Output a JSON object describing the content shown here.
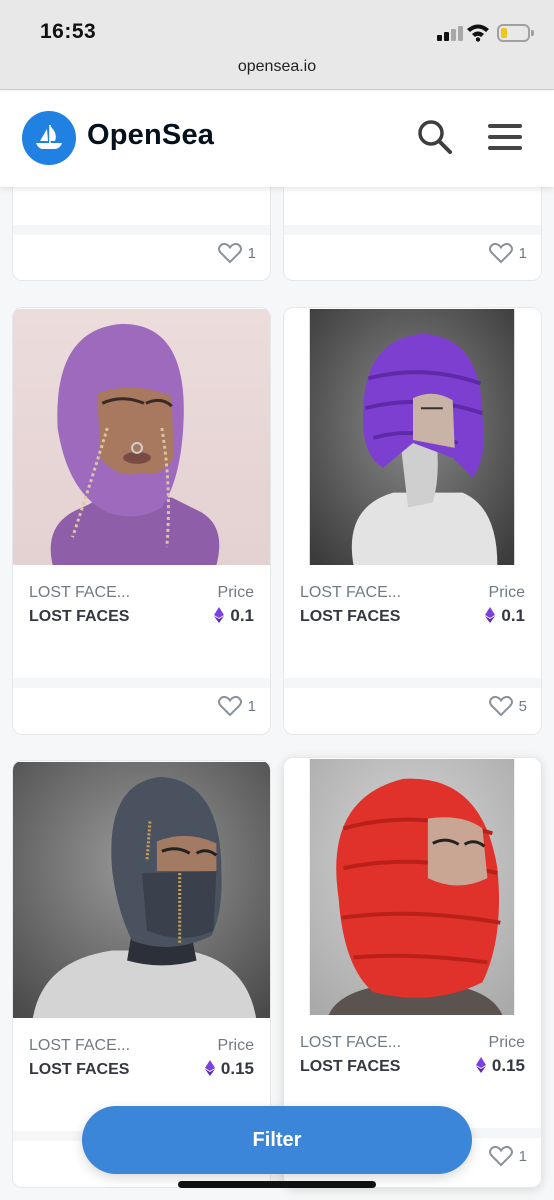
{
  "status": {
    "time": "16:53",
    "url": "opensea.io"
  },
  "header": {
    "brand": "OpenSea"
  },
  "cards": [
    {
      "id": "partial-left",
      "likes": "1"
    },
    {
      "id": "partial-right",
      "likes": "1"
    },
    {
      "id": "purple-knit",
      "collection_short": "LOST FACE...",
      "collection": "LOST FACES",
      "price_label": "Price",
      "price": "0.1",
      "likes": "1"
    },
    {
      "id": "purple-puffer",
      "collection_short": "LOST FACE...",
      "collection": "LOST FACES",
      "price_label": "Price",
      "price": "0.1",
      "likes": "5"
    },
    {
      "id": "grey-zip",
      "collection_short": "LOST FACE...",
      "collection": "LOST FACES",
      "price_label": "Price",
      "price": "0.15",
      "likes": ""
    },
    {
      "id": "red-puffer",
      "collection_short": "LOST FACE...",
      "collection": "LOST FACES",
      "price_label": "Price",
      "price": "0.15",
      "likes": "1"
    }
  ],
  "filter_label": "Filter",
  "colors": {
    "brand_blue": "#2081e2",
    "filter_blue": "#3b86d9",
    "eth_purple": "#7b3fe4"
  },
  "icons": [
    "opensea-logo-icon",
    "search-icon",
    "menu-icon",
    "heart-icon",
    "eth-icon",
    "signal-icon",
    "wifi-icon",
    "battery-icon"
  ]
}
